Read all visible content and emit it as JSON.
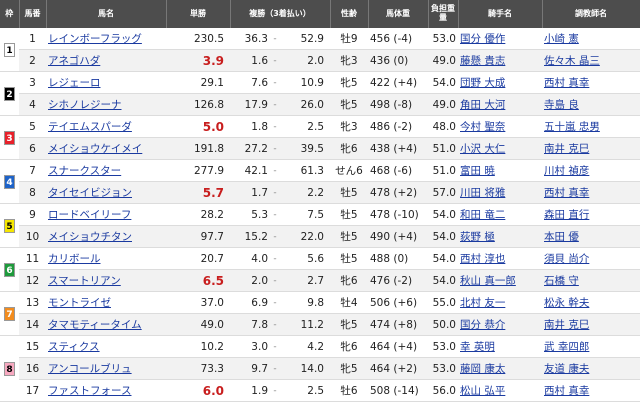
{
  "headers": {
    "waku": "枠",
    "umaban": "馬番",
    "horse": "馬名",
    "win": "単勝",
    "place": "複勝（3着払い）",
    "sexage": "性齢",
    "weight": "馬体重",
    "burden": "負担重量",
    "jockey": "騎手名",
    "trainer": "調教師名"
  },
  "colors": {
    "header_bg": "#4d4d4d",
    "link": "#1a3aa0",
    "hot_odds": "#c81e1e",
    "waku_1": "#ffffff",
    "waku_2": "#000000",
    "waku_3": "#e8202a",
    "waku_4": "#1e63c8",
    "waku_5": "#f5e600",
    "waku_6": "#1e9a3c",
    "waku_7": "#f28c1e",
    "waku_8": "#f7a9c0"
  },
  "waku_groups": [
    {
      "label": "1",
      "rows": 2,
      "bg": "#ffffff",
      "fg": "#000000"
    },
    {
      "label": "2",
      "rows": 2,
      "bg": "#000000",
      "fg": "#ffffff"
    },
    {
      "label": "3",
      "rows": 2,
      "bg": "#e8202a",
      "fg": "#ffffff"
    },
    {
      "label": "4",
      "rows": 2,
      "bg": "#1e63c8",
      "fg": "#ffffff"
    },
    {
      "label": "5",
      "rows": 2,
      "bg": "#f5e600",
      "fg": "#000000"
    },
    {
      "label": "6",
      "rows": 2,
      "bg": "#1e9a3c",
      "fg": "#ffffff"
    },
    {
      "label": "7",
      "rows": 2,
      "bg": "#f28c1e",
      "fg": "#ffffff"
    },
    {
      "label": "8",
      "rows": 3,
      "bg": "#f7a9c0",
      "fg": "#000000"
    }
  ],
  "rows": [
    {
      "num": "1",
      "horse": "レインボーフラッグ",
      "win": "230.5",
      "hot": false,
      "plow": "36.3",
      "sep": "-",
      "phigh": "52.9",
      "sexage": "牡9",
      "weight": "456 (-4)",
      "burden": "53.0",
      "jockey": "国分 優作",
      "trainer": "小崎 憲"
    },
    {
      "num": "2",
      "horse": "アネゴハダ",
      "win": "3.9",
      "hot": true,
      "plow": "1.6",
      "sep": "-",
      "phigh": "2.0",
      "sexage": "牝3",
      "weight": "436 (0)",
      "burden": "49.0",
      "jockey": "藤懸 貴志",
      "trainer": "佐々木 晶三"
    },
    {
      "num": "3",
      "horse": "レジェーロ",
      "win": "29.1",
      "hot": false,
      "plow": "7.6",
      "sep": "-",
      "phigh": "10.9",
      "sexage": "牝5",
      "weight": "422 (+4)",
      "burden": "54.0",
      "jockey": "団野 大成",
      "trainer": "西村 真幸"
    },
    {
      "num": "4",
      "horse": "シホノレジーナ",
      "win": "126.8",
      "hot": false,
      "plow": "17.9",
      "sep": "-",
      "phigh": "26.0",
      "sexage": "牝5",
      "weight": "498 (-8)",
      "burden": "49.0",
      "jockey": "角田 大河",
      "trainer": "寺島 良"
    },
    {
      "num": "5",
      "horse": "テイエムスパーダ",
      "win": "5.0",
      "hot": true,
      "plow": "1.8",
      "sep": "-",
      "phigh": "2.5",
      "sexage": "牝3",
      "weight": "486 (-2)",
      "burden": "48.0",
      "jockey": "今村 聖奈",
      "trainer": "五十嵐 忠男"
    },
    {
      "num": "6",
      "horse": "メイショウケイメイ",
      "win": "191.8",
      "hot": false,
      "plow": "27.2",
      "sep": "-",
      "phigh": "39.5",
      "sexage": "牝6",
      "weight": "438 (+4)",
      "burden": "51.0",
      "jockey": "小沢 大仁",
      "trainer": "南井 克巳"
    },
    {
      "num": "7",
      "horse": "スナークスター",
      "win": "277.9",
      "hot": false,
      "plow": "42.1",
      "sep": "-",
      "phigh": "61.3",
      "sexage": "せん6",
      "weight": "468 (-6)",
      "burden": "51.0",
      "jockey": "富田 暁",
      "trainer": "川村 禎彦"
    },
    {
      "num": "8",
      "horse": "タイセイビジョン",
      "win": "5.7",
      "hot": true,
      "plow": "1.7",
      "sep": "-",
      "phigh": "2.2",
      "sexage": "牡5",
      "weight": "478 (+2)",
      "burden": "57.0",
      "jockey": "川田 将雅",
      "trainer": "西村 真幸"
    },
    {
      "num": "9",
      "horse": "ロードベイリーフ",
      "win": "28.2",
      "hot": false,
      "plow": "5.3",
      "sep": "-",
      "phigh": "7.5",
      "sexage": "牡5",
      "weight": "478 (-10)",
      "burden": "54.0",
      "jockey": "和田 竜二",
      "trainer": "森田 直行"
    },
    {
      "num": "10",
      "horse": "メイショウチタン",
      "win": "97.7",
      "hot": false,
      "plow": "15.2",
      "sep": "-",
      "phigh": "22.0",
      "sexage": "牡5",
      "weight": "490 (+4)",
      "burden": "54.0",
      "jockey": "荻野 極",
      "trainer": "本田 優"
    },
    {
      "num": "11",
      "horse": "カリボール",
      "win": "20.7",
      "hot": false,
      "plow": "4.0",
      "sep": "-",
      "phigh": "5.6",
      "sexage": "牡5",
      "weight": "488 (0)",
      "burden": "54.0",
      "jockey": "西村 淳也",
      "trainer": "須貝 尚介"
    },
    {
      "num": "12",
      "horse": "スマートリアン",
      "win": "6.5",
      "hot": true,
      "plow": "2.0",
      "sep": "-",
      "phigh": "2.7",
      "sexage": "牝6",
      "weight": "476 (-2)",
      "burden": "54.0",
      "jockey": "秋山 真一郎",
      "trainer": "石橋 守"
    },
    {
      "num": "13",
      "horse": "モントライゼ",
      "win": "37.0",
      "hot": false,
      "plow": "6.9",
      "sep": "-",
      "phigh": "9.8",
      "sexage": "牡4",
      "weight": "506 (+6)",
      "burden": "55.0",
      "jockey": "北村 友一",
      "trainer": "松永 幹夫"
    },
    {
      "num": "14",
      "horse": "タマモティータイム",
      "win": "49.0",
      "hot": false,
      "plow": "7.8",
      "sep": "-",
      "phigh": "11.2",
      "sexage": "牝5",
      "weight": "474 (+8)",
      "burden": "50.0",
      "jockey": "国分 恭介",
      "trainer": "南井 克巳"
    },
    {
      "num": "15",
      "horse": "スティクス",
      "win": "10.2",
      "hot": false,
      "plow": "3.0",
      "sep": "-",
      "phigh": "4.2",
      "sexage": "牝6",
      "weight": "464 (+4)",
      "burden": "53.0",
      "jockey": "幸 英明",
      "trainer": "武 幸四郎"
    },
    {
      "num": "16",
      "horse": "アンコールブリュ",
      "win": "73.3",
      "hot": false,
      "plow": "9.7",
      "sep": "-",
      "phigh": "14.0",
      "sexage": "牝5",
      "weight": "464 (+2)",
      "burden": "53.0",
      "jockey": "藤岡 康太",
      "trainer": "友道 康夫"
    },
    {
      "num": "17",
      "horse": "ファストフォース",
      "win": "6.0",
      "hot": true,
      "plow": "1.9",
      "sep": "-",
      "phigh": "2.5",
      "sexage": "牡6",
      "weight": "508 (-14)",
      "burden": "56.0",
      "jockey": "松山 弘平",
      "trainer": "西村 真幸"
    }
  ]
}
